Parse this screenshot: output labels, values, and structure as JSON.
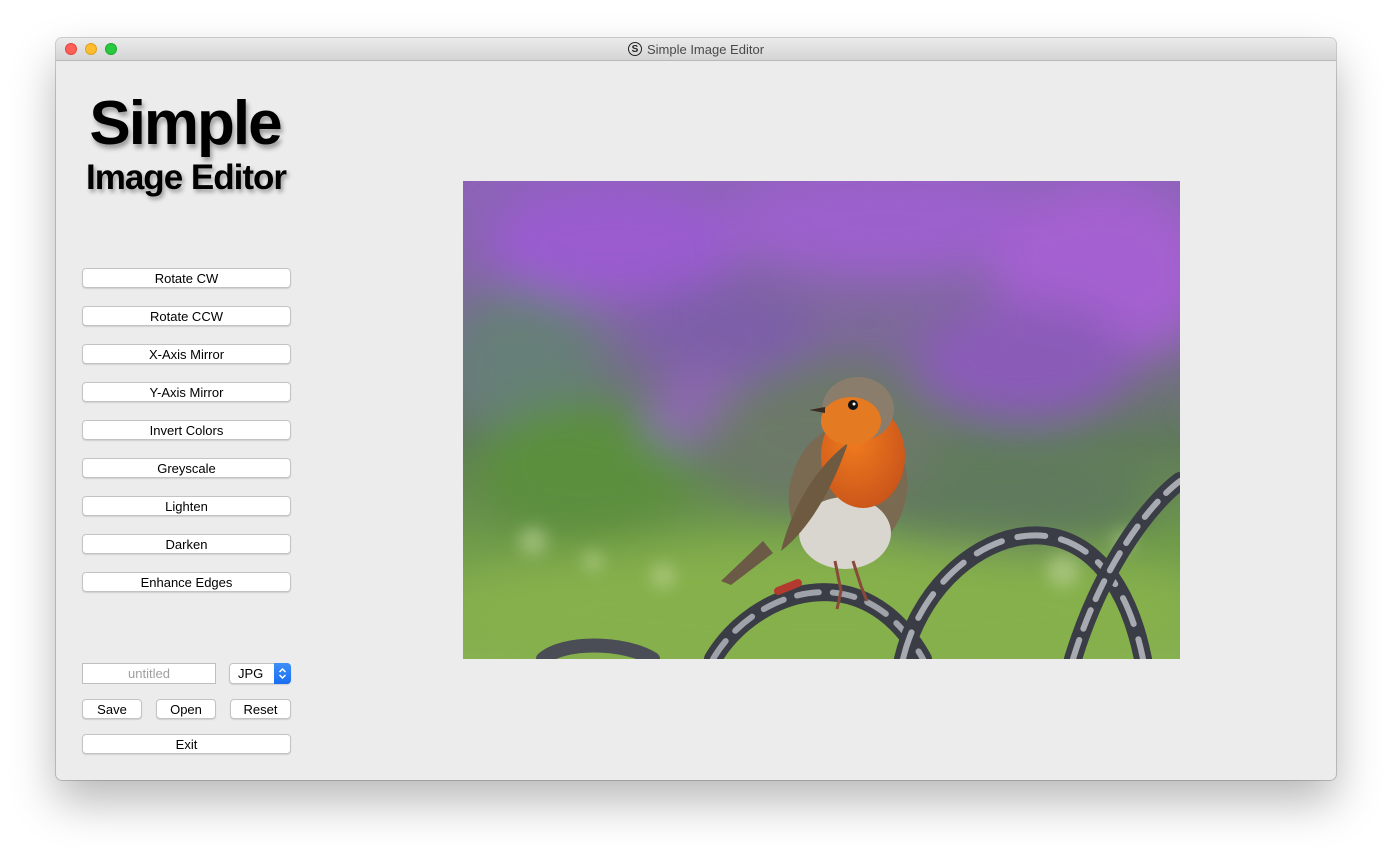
{
  "window": {
    "title": "Simple Image Editor"
  },
  "logo": {
    "line1": "Simple",
    "line2": "Image Editor"
  },
  "operations": [
    {
      "label": "Rotate CW"
    },
    {
      "label": "Rotate CCW"
    },
    {
      "label": "X-Axis Mirror"
    },
    {
      "label": "Y-Axis Mirror"
    },
    {
      "label": "Invert Colors"
    },
    {
      "label": "Greyscale"
    },
    {
      "label": "Lighten"
    },
    {
      "label": "Darken"
    },
    {
      "label": "Enhance Edges"
    }
  ],
  "file": {
    "filename_value": "",
    "filename_placeholder": "untitled",
    "format_selected": "JPG",
    "save_label": "Save",
    "open_label": "Open",
    "reset_label": "Reset",
    "exit_label": "Exit"
  },
  "image": {
    "subject": "robin-bird-photo"
  }
}
